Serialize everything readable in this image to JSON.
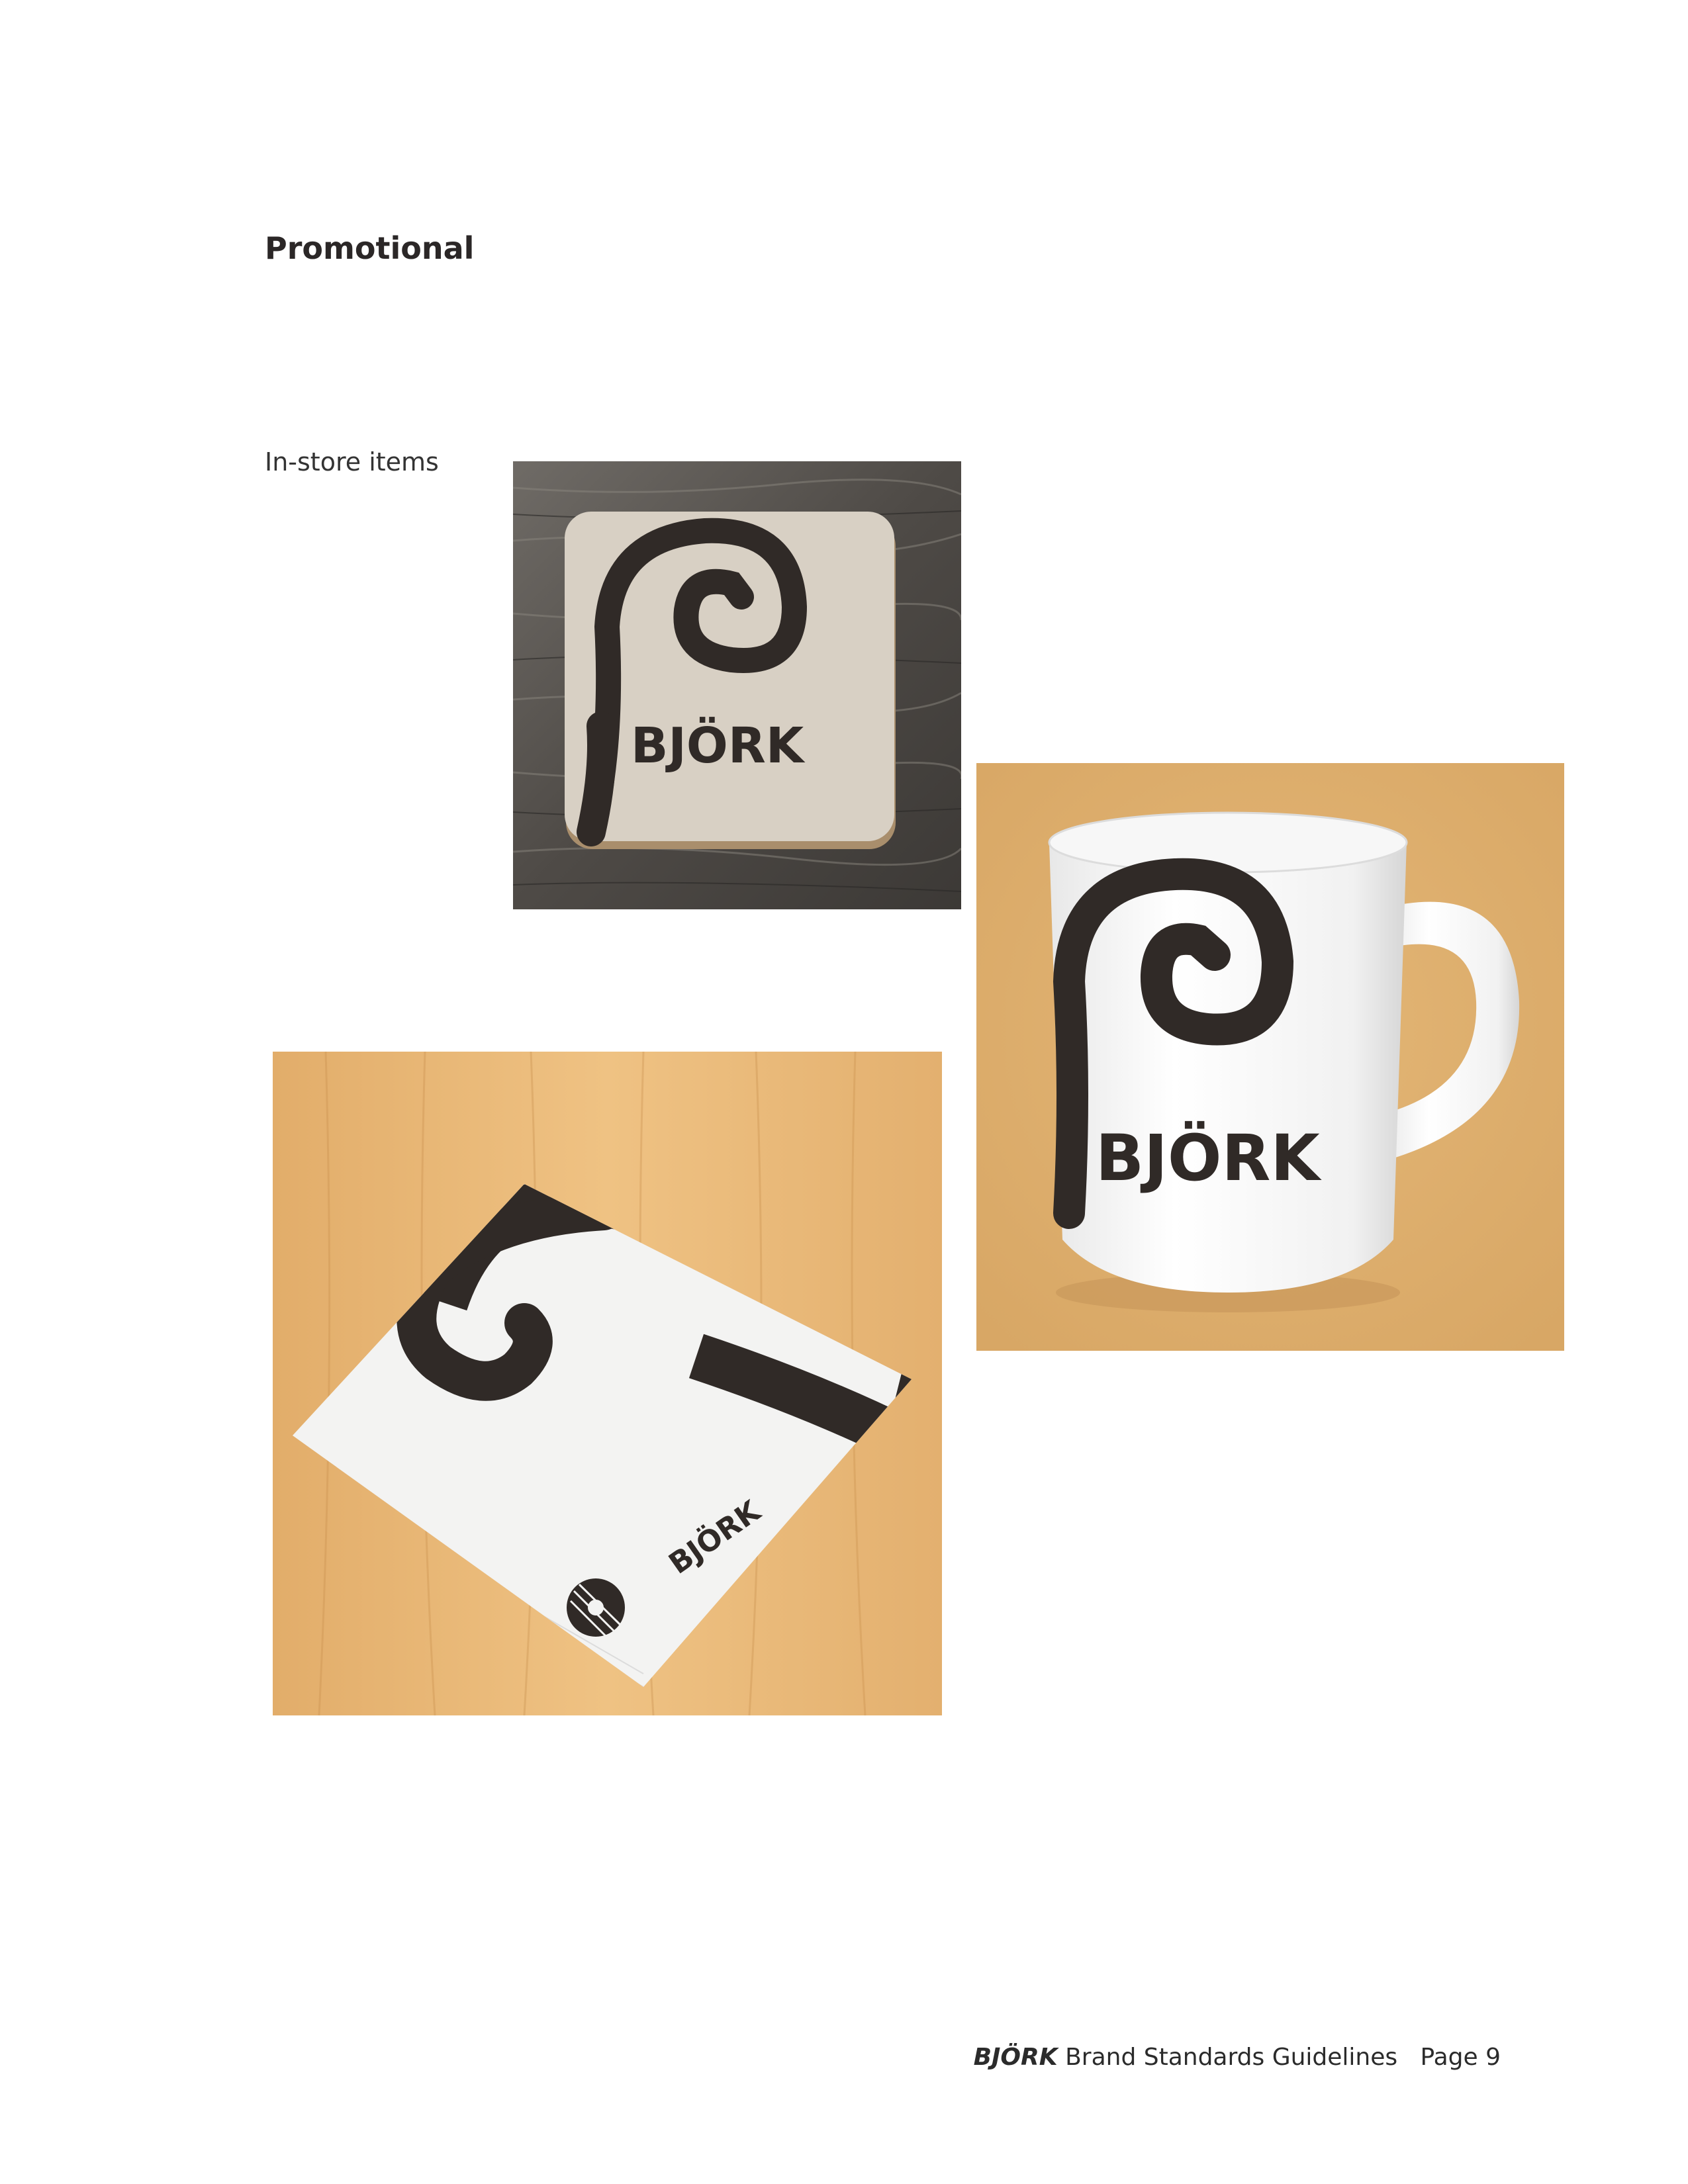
{
  "heading": "Promotional",
  "section_label": "In-store items",
  "logo_wordmark": "BJÖRK",
  "footer": {
    "brand": "BJÖRK",
    "text": " Brand Standards Guidelines",
    "page": "Page 9"
  },
  "colors": {
    "logo_dark": "#302a27",
    "mug_background": "#dcac6c",
    "coaster_board": "#d8d0c4",
    "wood_table": "#e9b877"
  }
}
